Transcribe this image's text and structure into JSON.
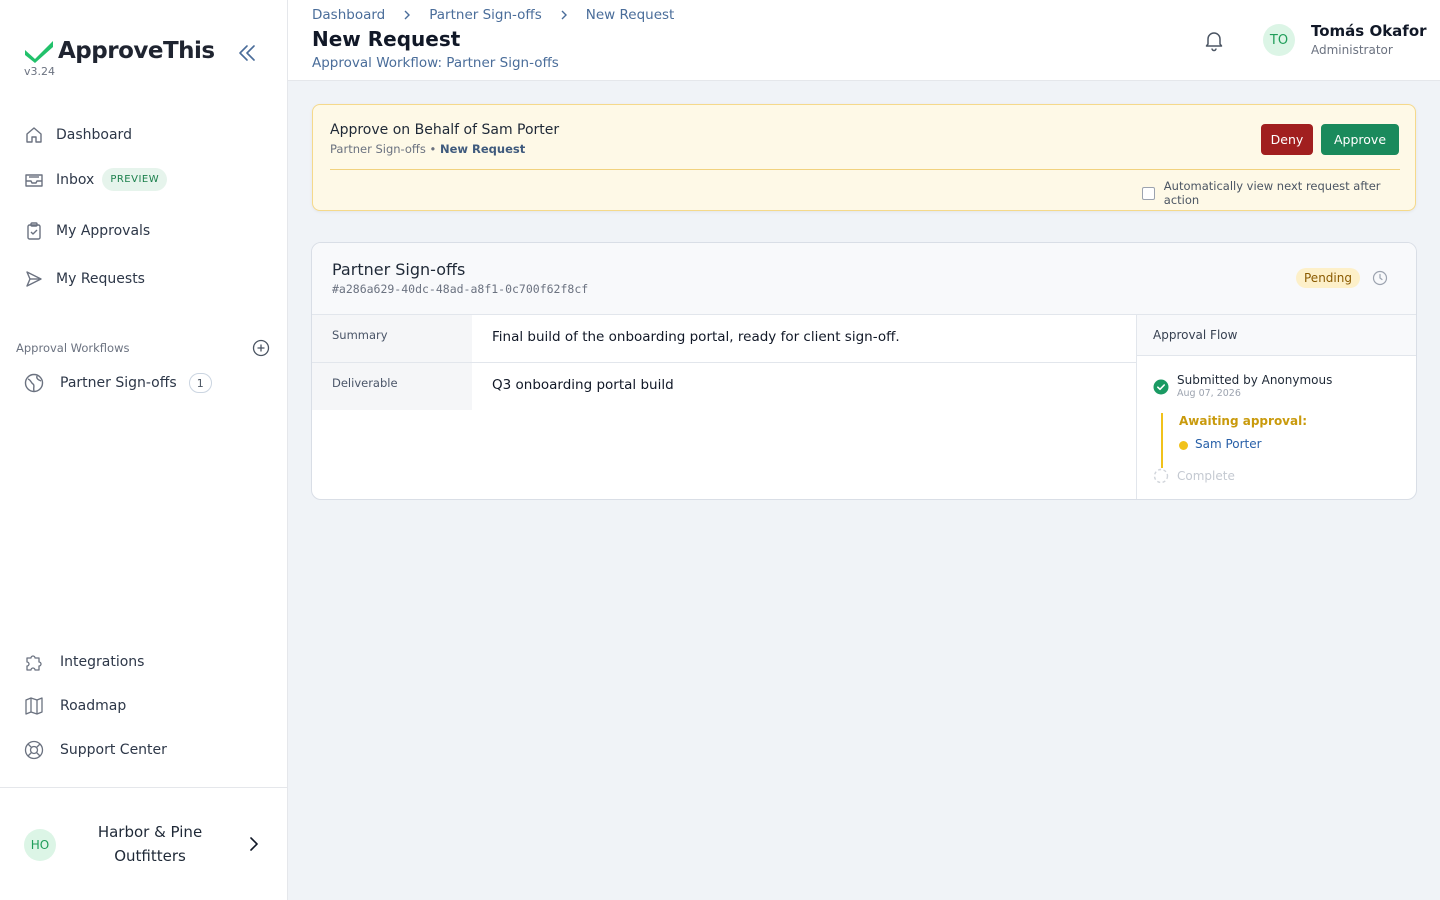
{
  "app": {
    "name": "ApproveThis",
    "version": "v3.24",
    "brand_color": "#22c16b"
  },
  "sidebar": {
    "items": [
      {
        "label": "Dashboard",
        "icon": "home-icon"
      },
      {
        "label": "Inbox",
        "icon": "inbox-icon",
        "badge": "PREVIEW"
      },
      {
        "label": "My Approvals",
        "icon": "clipboard-check-icon"
      },
      {
        "label": "My Requests",
        "icon": "send-icon"
      }
    ],
    "workflows_label": "Approval Workflows",
    "workflows": [
      {
        "label": "Partner Sign-offs",
        "icon": "globe-icon",
        "count": "1"
      }
    ],
    "bottom_items": [
      {
        "label": "Integrations",
        "icon": "puzzle-icon"
      },
      {
        "label": "Roadmap",
        "icon": "map-icon"
      },
      {
        "label": "Support Center",
        "icon": "lifebuoy-icon"
      }
    ],
    "org": {
      "initials": "HO",
      "name": "Harbor & Pine Outfitters"
    }
  },
  "header": {
    "breadcrumb": [
      "Dashboard",
      "Partner Sign-offs",
      "New Request"
    ],
    "title": "New Request",
    "subtitle": "Approval Workflow: Partner Sign-offs",
    "user": {
      "initials": "TO",
      "name": "Tomás Okafor",
      "role": "Administrator"
    }
  },
  "banner": {
    "title": "Approve on Behalf of Sam Porter",
    "sub_workflow": "Partner Sign-offs",
    "sub_separator": " • ",
    "sub_request": "New Request",
    "deny_label": "Deny",
    "approve_label": "Approve",
    "auto_next_label": "Automatically view next request after action",
    "auto_next_checked": false,
    "deny_color": "#a11f1f",
    "approve_color": "#1a8a5c"
  },
  "request": {
    "workflow_name": "Partner Sign-offs",
    "id": "#a286a629-40dc-48ad-a8f1-0c700f62f8cf",
    "status": "Pending",
    "fields": [
      {
        "label": "Summary",
        "value": "Final build of the onboarding portal, ready for client sign-off."
      },
      {
        "label": "Deliverable",
        "value": "Q3 onboarding portal build"
      }
    ]
  },
  "approval_flow": {
    "title": "Approval Flow",
    "submitted": "Submitted by Anonymous",
    "submitted_date": "Aug 07, 2026",
    "awaiting_label": "Awaiting approval:",
    "approver": "Sam Porter",
    "complete_label": "Complete"
  }
}
